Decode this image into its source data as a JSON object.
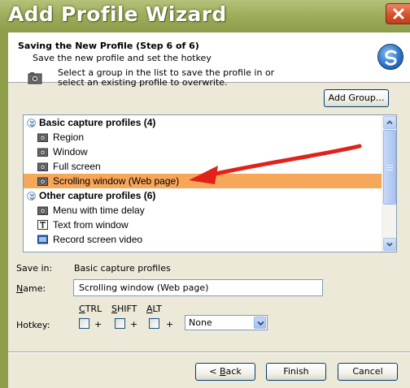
{
  "window": {
    "title": "Add Profile Wizard"
  },
  "header": {
    "step_title": "Saving the New Profile (Step 6 of 6)",
    "subtitle": "Save the new profile and set the hotkey"
  },
  "instructions": {
    "line1": "Select a group in the list to save the profile in or",
    "line2": "select an existing profile to overwrite."
  },
  "add_group_button": "Add Group...",
  "profile_list": {
    "groups": [
      {
        "label": "Basic capture profiles (4)",
        "items": [
          {
            "label": "Region",
            "icon": "camera-icon"
          },
          {
            "label": "Window",
            "icon": "camera-icon"
          },
          {
            "label": "Full screen",
            "icon": "camera-icon"
          },
          {
            "label": "Scrolling window (Web page)",
            "icon": "camera-icon",
            "selected": true
          }
        ]
      },
      {
        "label": "Other capture profiles (6)",
        "items": [
          {
            "label": "Menu with time delay",
            "icon": "camera-icon"
          },
          {
            "label": "Text from window",
            "icon": "text-capture-icon"
          },
          {
            "label": "Record screen video",
            "icon": "video-icon"
          }
        ]
      }
    ],
    "annotation": "red-arrow-pointing-at-selection"
  },
  "save_in": {
    "label": "Save in:",
    "value": "Basic capture profiles"
  },
  "name_field": {
    "label": "Name:",
    "value": "Scrolling window (Web page)"
  },
  "hotkey": {
    "label": "Hotkey:",
    "modifiers": [
      "CTRL",
      "SHIFT",
      "ALT"
    ],
    "plus": "+",
    "key_value": "None"
  },
  "buttons": {
    "back": "< Back",
    "finish": "Finish",
    "cancel": "Cancel"
  },
  "colors": {
    "selection": "#f7a75a",
    "title_bar": "#9fae5c",
    "close_button": "#d4532c",
    "arrow": "#e0221b"
  }
}
